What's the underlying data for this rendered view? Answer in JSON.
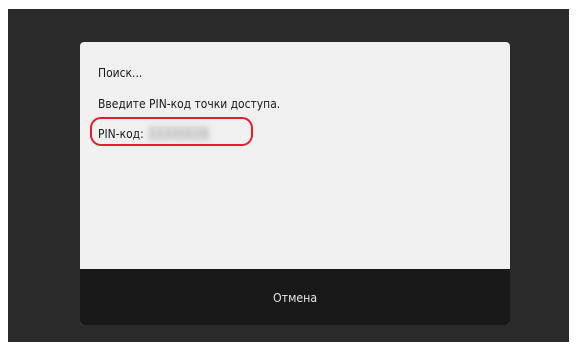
{
  "dialog": {
    "status_text": "Поиск...",
    "instruction_text": "Введите PIN-код точки доступа.",
    "pin_label": "PIN-код:",
    "pin_value": "12345678"
  },
  "footer": {
    "cancel_label": "Отмена"
  },
  "colors": {
    "screen_background": "#2a2a2a",
    "dialog_background": "#f0f0f0",
    "footer_background": "#191919",
    "highlight_ring": "#e0202c"
  }
}
